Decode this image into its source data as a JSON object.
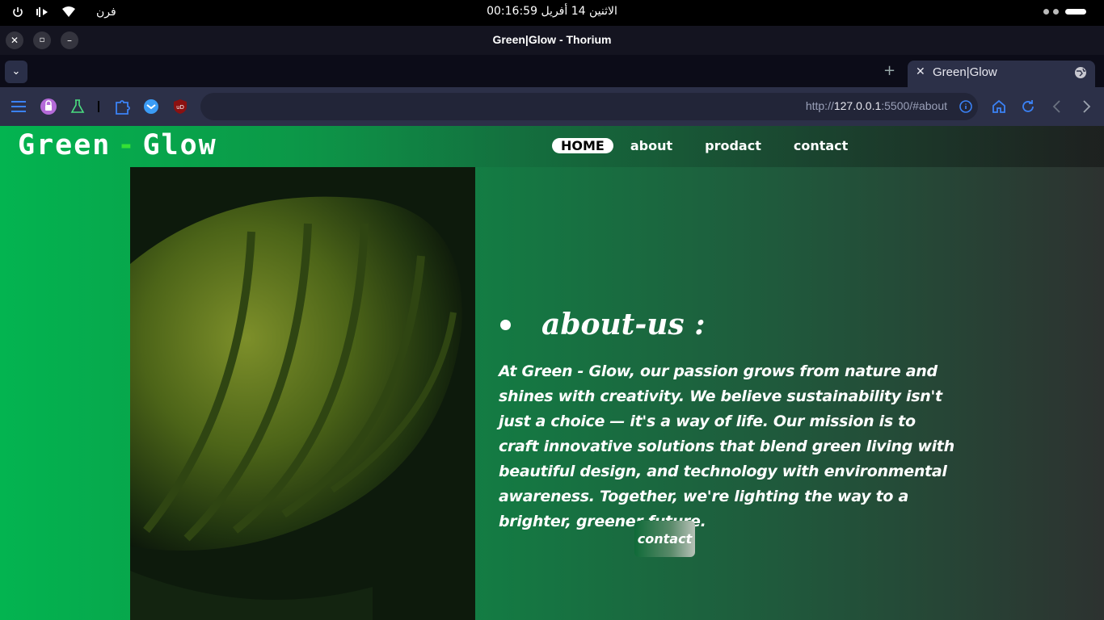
{
  "os_bar": {
    "clock": "الاثنين 14 أفريل  00:16:59",
    "language": "فرن"
  },
  "window": {
    "title": "Green|Glow - Thorium"
  },
  "tabs": [
    {
      "label": "Green|Glow",
      "active": true
    }
  ],
  "toolbar": {
    "url_prefix": "http://",
    "url_host": "127.0.0.1",
    "url_rest": ":5500/#about"
  },
  "site": {
    "logo_left": "Green",
    "logo_dash": "-",
    "logo_right": "Glow",
    "nav": [
      {
        "label": "HOME",
        "active": true
      },
      {
        "label": "about",
        "active": false
      },
      {
        "label": "prodact",
        "active": false
      },
      {
        "label": "contact",
        "active": false
      }
    ],
    "about_title": "about-us :",
    "about_text": "At Green - Glow, our passion grows from nature and shines with creativity. We believe sustainability isn't just a choice — it's a way of life. Our mission is to craft innovative solutions that blend green living with beautiful design, and technology with environmental awareness. Together, we're lighting the way to a brighter, greener future.",
    "contact_button": "contact"
  },
  "colors": {
    "accent_green": "#03b450",
    "logo_dash": "#35e035",
    "browser_chrome": "#2c3048"
  }
}
